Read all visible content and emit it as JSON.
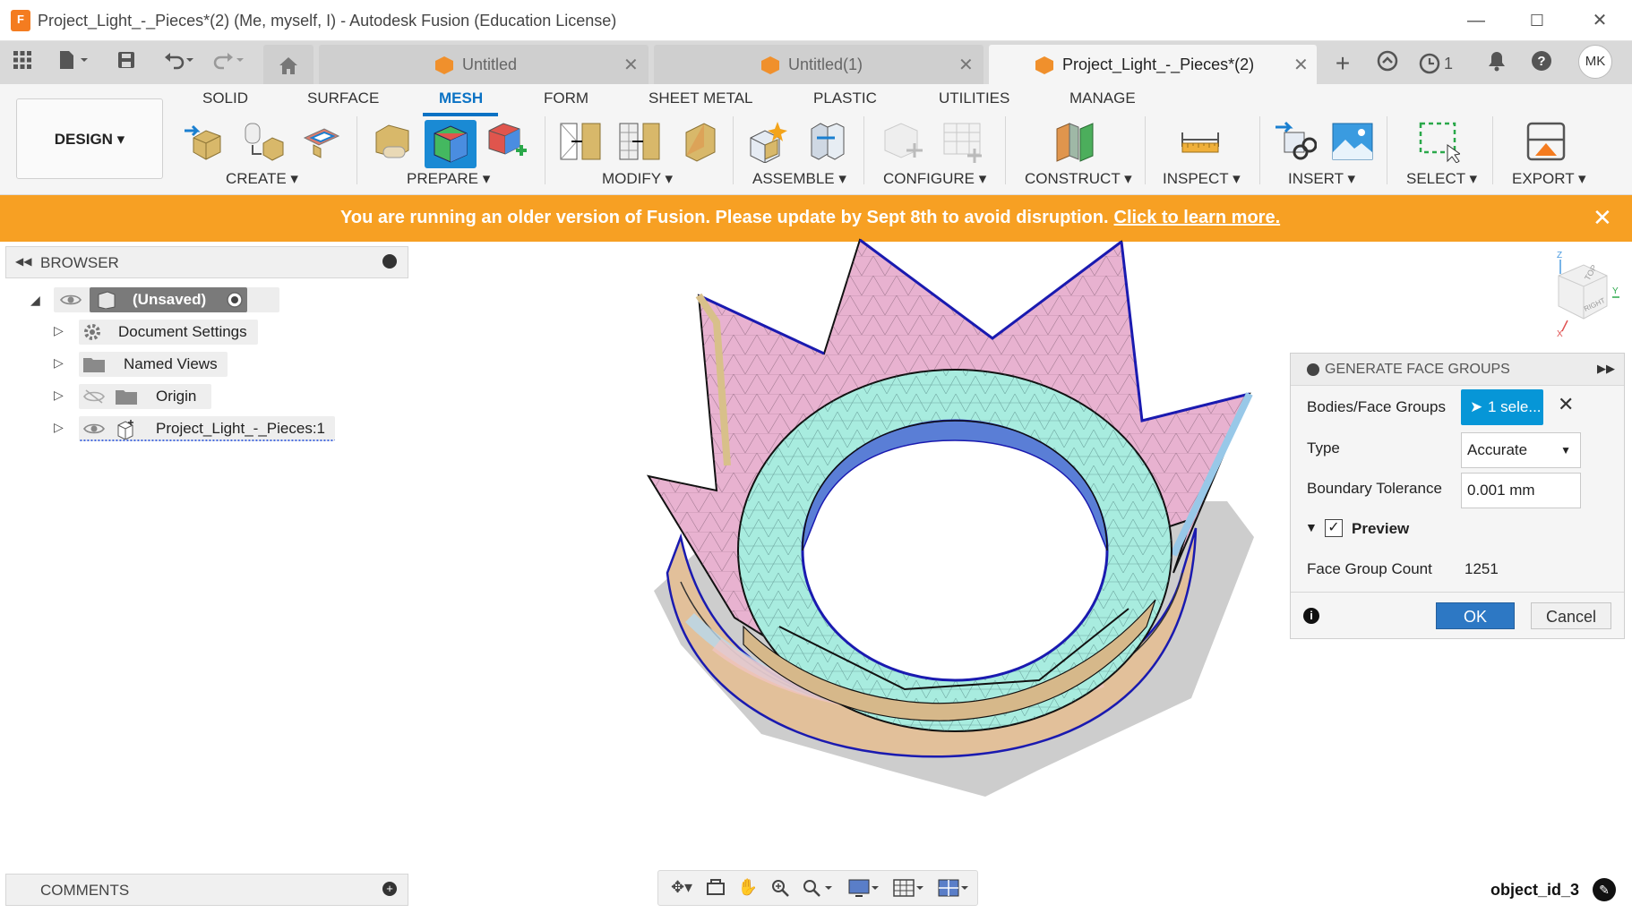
{
  "window": {
    "title": "Project_Light_-_Pieces*(2) (Me, myself, I) - Autodesk Fusion (Education License)",
    "app_icon": "F",
    "minimize": "—",
    "maximize": "☐",
    "close": "✕"
  },
  "tabs": [
    {
      "label": "Untitled",
      "close": "✕",
      "active": false
    },
    {
      "label": "Untitled(1)",
      "close": "✕",
      "active": false
    },
    {
      "label": "Project_Light_-_Pieces*(2)",
      "close": "✕",
      "active": true
    }
  ],
  "tabbar_right": {
    "job_count": "1",
    "user_initials": "MK"
  },
  "ribbon": {
    "design_button": "DESIGN ▾",
    "tabs": [
      "SOLID",
      "SURFACE",
      "MESH",
      "FORM",
      "SHEET METAL",
      "PLASTIC",
      "UTILITIES",
      "MANAGE"
    ],
    "active_tab": "MESH",
    "groups": [
      "CREATE ▾",
      "PREPARE ▾",
      "MODIFY ▾",
      "ASSEMBLE ▾",
      "CONFIGURE ▾",
      "CONSTRUCT ▾",
      "INSPECT ▾",
      "INSERT ▾",
      "SELECT ▾",
      "EXPORT ▾"
    ]
  },
  "banner": {
    "message": "You are running an older version of Fusion. Please update by Sept 8th to avoid disruption.",
    "link": "Click to learn more.",
    "close": "✕",
    "color": "#f7a023"
  },
  "browser": {
    "header": "BROWSER",
    "root": "(Unsaved)",
    "items": [
      {
        "label": "Document Settings",
        "icon": "gear-icon"
      },
      {
        "label": "Named Views",
        "icon": "folder-icon"
      },
      {
        "label": "Origin",
        "icon": "folder-icon"
      },
      {
        "label": "Project_Light_-_Pieces:1",
        "icon": "component-icon"
      }
    ]
  },
  "comments": {
    "header": "COMMENTS"
  },
  "panel": {
    "title": "GENERATE FACE GROUPS",
    "bodies_label": "Bodies/Face Groups",
    "bodies_value": "1 sele...",
    "type_label": "Type",
    "type_value": "Accurate",
    "tolerance_label": "Boundary Tolerance",
    "tolerance_value": "0.001 mm",
    "preview_label": "Preview",
    "preview_checked": true,
    "count_label": "Face Group Count",
    "count_value": "1251",
    "ok": "OK",
    "cancel": "Cancel"
  },
  "viewcube": {
    "top": "TOP",
    "right": "RIGHT",
    "axis_z": "Z",
    "axis_y": "Y",
    "axis_x": "X"
  },
  "status": {
    "object_id": "object_id_3"
  },
  "colors": {
    "accent": "#0696d7",
    "mesh_tab": "#0a72c4",
    "ok_button": "#2d78c4"
  }
}
